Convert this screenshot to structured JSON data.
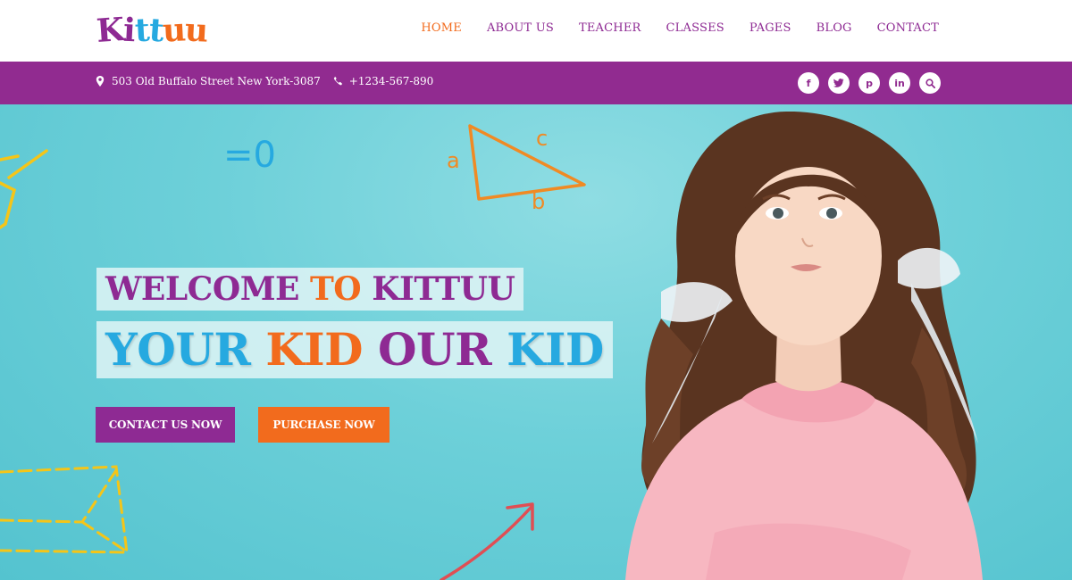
{
  "logo": {
    "text": "Kittuu",
    "letters": [
      "K",
      "i",
      "t",
      "t",
      "u",
      "u"
    ]
  },
  "nav": {
    "items": [
      {
        "label": "HOME",
        "active": true
      },
      {
        "label": "ABOUT US",
        "active": false
      },
      {
        "label": "TEACHER",
        "active": false
      },
      {
        "label": "CLASSES",
        "active": false
      },
      {
        "label": "PAGES",
        "active": false
      },
      {
        "label": "BLOG",
        "active": false
      },
      {
        "label": "CONTACT",
        "active": false
      }
    ]
  },
  "topbar": {
    "address": "503 Old Buffalo Street New York-3087",
    "phone": "+1234-567-890",
    "address_icon": "map-marker-icon",
    "phone_icon": "phone-icon",
    "socials": [
      {
        "name": "facebook-icon",
        "glyph": "f"
      },
      {
        "name": "twitter-icon",
        "glyph": "t"
      },
      {
        "name": "pinterest-icon",
        "glyph": "p"
      },
      {
        "name": "linkedin-icon",
        "glyph": "in"
      },
      {
        "name": "search-icon",
        "glyph": ""
      }
    ]
  },
  "hero": {
    "line1": {
      "a": "WELCOME ",
      "b": "TO ",
      "c": "KITTUU"
    },
    "line2": {
      "a": "YOUR ",
      "b": "KID ",
      "c": "OUR ",
      "d": "KID"
    },
    "doodles": {
      "equals": "=0",
      "tri_a": "a",
      "tri_b": "b",
      "tri_c": "c"
    },
    "buttons": {
      "contact": "CONTACT US NOW",
      "purchase": "PURCHASE NOW"
    }
  },
  "colors": {
    "brand_purple": "#8e2a93",
    "brand_orange": "#f26b1d",
    "brand_blue": "#26a9e0",
    "topbar": "#912b90",
    "hero_bg": "#6dd0d9"
  }
}
